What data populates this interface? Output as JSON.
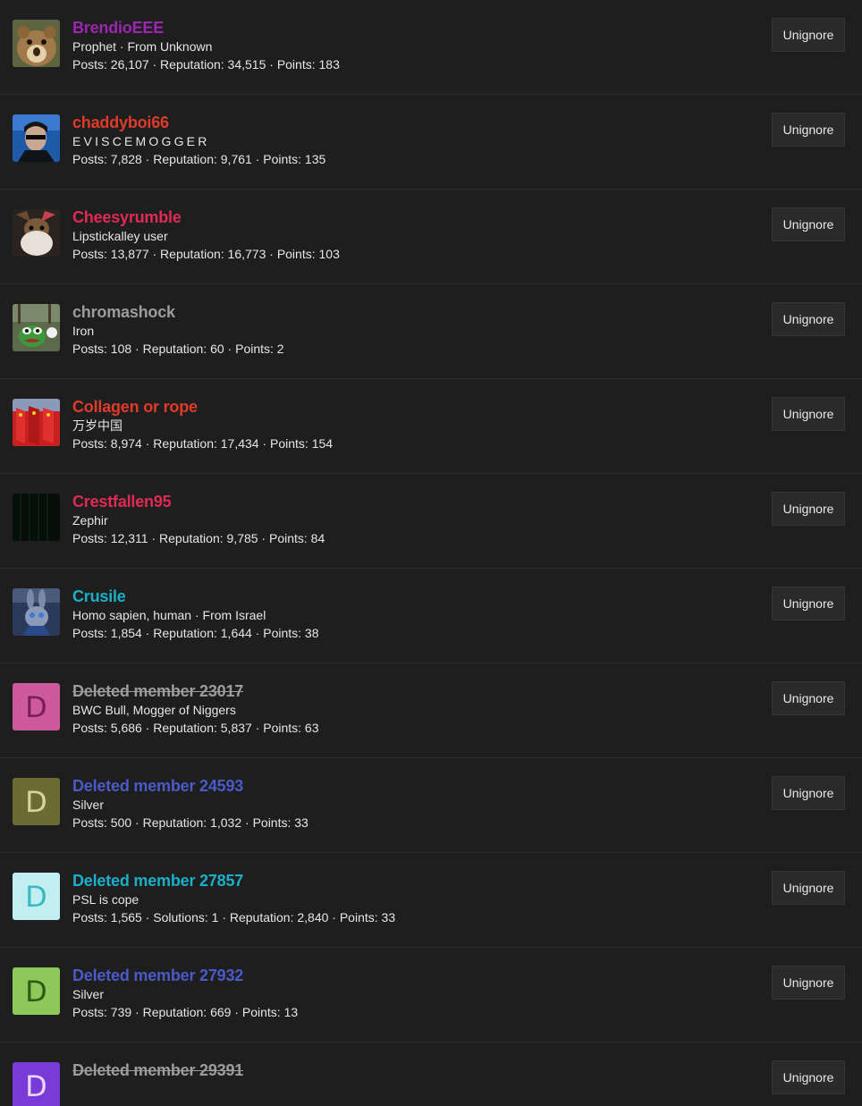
{
  "members": [
    {
      "name": "BrendioEEE",
      "name_color": "#9b27b0",
      "deleted": false,
      "title": "Prophet · From Unknown",
      "stats": "Posts: 26,107 · Reputation: 34,515 · Points: 183",
      "avatar": {
        "type": "image",
        "icon": "hamster-face-avatar"
      },
      "button": "Unignore"
    },
    {
      "name": "chaddyboi66",
      "name_color": "#e03a2a",
      "deleted": false,
      "title": "EVISCEMOGGER",
      "title_spaced": true,
      "stats": "Posts: 7,828 · Reputation: 9,761 · Points: 135",
      "avatar": {
        "type": "image",
        "icon": "man-sunglasses-avatar"
      },
      "button": "Unignore"
    },
    {
      "name": "Cheesyrumble",
      "name_color": "#e02a55",
      "deleted": false,
      "title": "Lipstickalley user",
      "stats": "Posts: 13,877 · Reputation: 16,773 · Points: 103",
      "avatar": {
        "type": "image",
        "icon": "bearded-figure-avatar"
      },
      "button": "Unignore"
    },
    {
      "name": "chromashock",
      "name_color": "#9c9c9c",
      "deleted": false,
      "title": "Iron",
      "stats": "Posts: 108 · Reputation: 60 · Points: 2",
      "avatar": {
        "type": "image",
        "icon": "frog-avatar"
      },
      "button": "Unignore"
    },
    {
      "name": "Collagen or rope",
      "name_color": "#e03a2a",
      "deleted": false,
      "title": "万岁中国",
      "stats": "Posts: 8,974 · Reputation: 17,434 · Points: 154",
      "avatar": {
        "type": "image",
        "icon": "red-flags-avatar"
      },
      "button": "Unignore"
    },
    {
      "name": "Crestfallen95",
      "name_color": "#e02a55",
      "deleted": false,
      "title": "Zephir",
      "stats": "Posts: 12,311 · Reputation: 9,785 · Points: 84",
      "avatar": {
        "type": "image",
        "icon": "dark-pattern-avatar"
      },
      "button": "Unignore"
    },
    {
      "name": "Crusile",
      "name_color": "#1ab0c8",
      "deleted": false,
      "title": "Homo sapien, human · From Israel",
      "stats": "Posts: 1,854 · Reputation: 1,644 · Points: 38",
      "avatar": {
        "type": "image",
        "icon": "rabbit-character-avatar"
      },
      "button": "Unignore"
    },
    {
      "name": "Deleted member 23017",
      "name_color": "#9c9c9c",
      "deleted": true,
      "title": "BWC Bull, Mogger of Niggers",
      "stats": "Posts: 5,686 · Reputation: 5,837 · Points: 63",
      "avatar": {
        "type": "letter",
        "letter": "D",
        "bg": "#cc5a9c",
        "fg": "#7a1f56"
      },
      "button": "Unignore"
    },
    {
      "name": "Deleted member 24593",
      "name_color": "#4a5ac8",
      "deleted": false,
      "title": "Silver",
      "stats": "Posts: 500 · Reputation: 1,032 · Points: 33",
      "avatar": {
        "type": "letter",
        "letter": "D",
        "bg": "#6b6b33",
        "fg": "#d6d69a"
      },
      "button": "Unignore"
    },
    {
      "name": "Deleted member 27857",
      "name_color": "#1ab0c8",
      "deleted": false,
      "title": "PSL is cope",
      "stats": "Posts: 1,565 · Solutions: 1 · Reputation: 2,840 · Points: 33",
      "avatar": {
        "type": "letter",
        "letter": "D",
        "bg": "#c2eef0",
        "fg": "#3ab8c4"
      },
      "button": "Unignore"
    },
    {
      "name": "Deleted member 27932",
      "name_color": "#4a5ac8",
      "deleted": false,
      "title": "Silver",
      "stats": "Posts: 739 · Reputation: 669 · Points: 13",
      "avatar": {
        "type": "letter",
        "letter": "D",
        "bg": "#8fc85a",
        "fg": "#2f5a15"
      },
      "button": "Unignore"
    },
    {
      "name": "Deleted member 29391",
      "name_color": "#9c9c9c",
      "deleted": true,
      "title": "",
      "stats": "",
      "avatar": {
        "type": "letter",
        "letter": "D",
        "bg": "#7a3ad8",
        "fg": "#e8d8ff"
      },
      "button": "Unignore"
    }
  ]
}
